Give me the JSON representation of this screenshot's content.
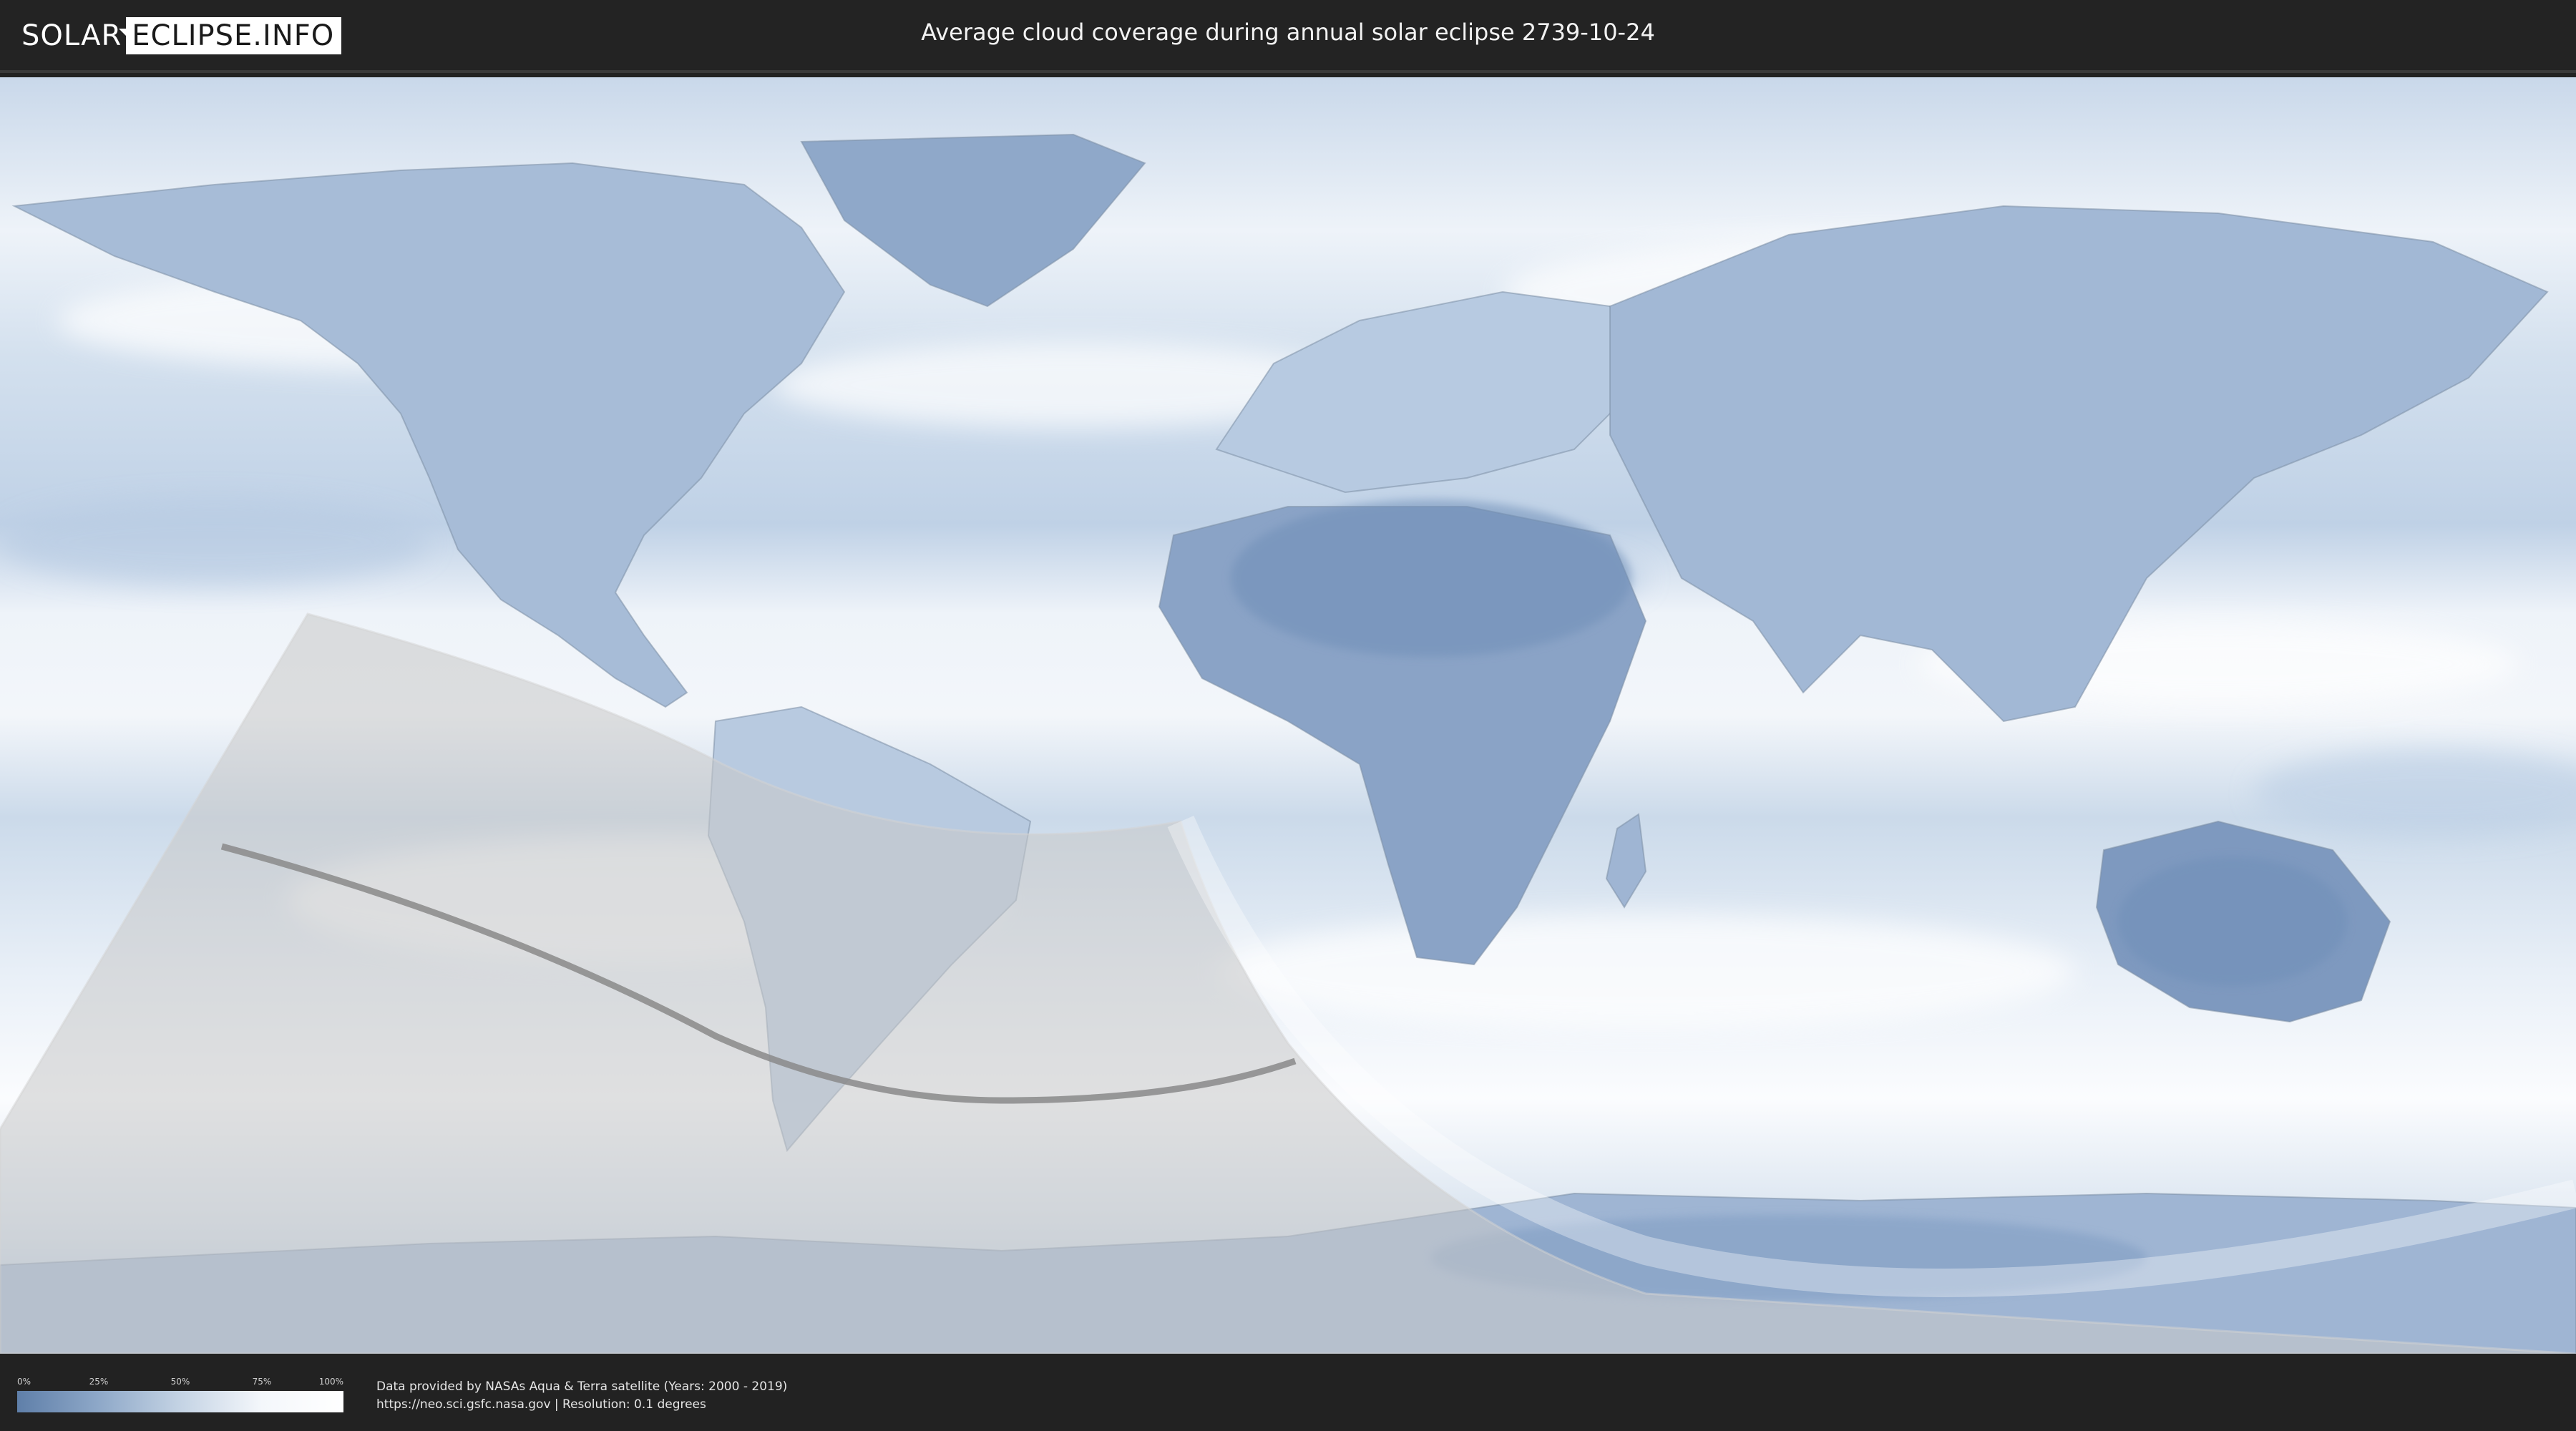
{
  "header": {
    "logo_left": "SOLAR",
    "logo_right": "ECLIPSE.INFO",
    "title": "Average cloud coverage during annual solar eclipse 2739-10-24"
  },
  "legend": {
    "ticks": [
      "0%",
      "25%",
      "50%",
      "75%",
      "100%"
    ],
    "gradient_colors": [
      "#5f7fa9",
      "#8ea8c8",
      "#c4d3e4",
      "#f4f7fb",
      "#ffffff"
    ]
  },
  "credits": {
    "line1": "Data provided by NASAs Aqua & Terra satellite (Years: 2000 - 2019)",
    "line2": "https://neo.sci.gsfc.nasa.gov | Resolution: 0.1 degrees"
  },
  "map": {
    "projection": "equirectangular",
    "eclipse_path_color": "#8a8a8a",
    "penumbra_shade": "#c8c8c8",
    "land_cloudy_color": "#6f8fb8"
  }
}
